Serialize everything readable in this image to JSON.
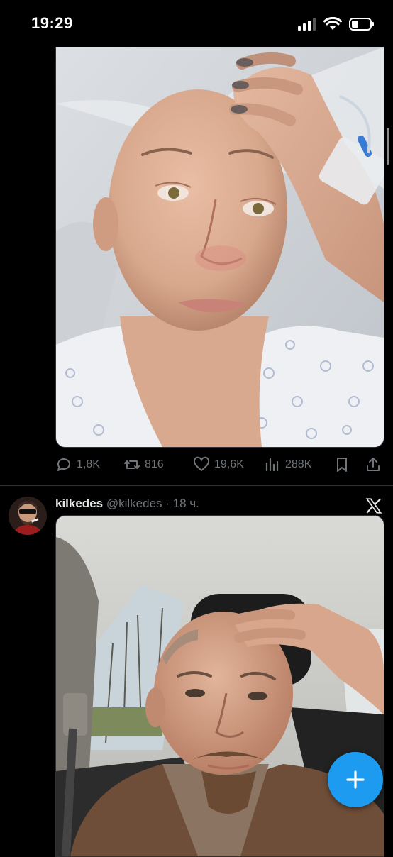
{
  "status_bar": {
    "time": "19:29"
  },
  "tweet1": {
    "actions": {
      "replies": "1,8K",
      "retweets": "816",
      "likes": "19,6K",
      "views": "288K"
    }
  },
  "tweet2": {
    "author_name": "kilkedes",
    "author_handle": "@kilkedes",
    "separator": "·",
    "time_ago": "18 ч."
  },
  "colors": {
    "accent": "#1d9bf0",
    "muted": "#71767b",
    "background": "#000000"
  },
  "icons": [
    "reply-icon",
    "retweet-icon",
    "like-icon",
    "views-icon",
    "bookmark-icon",
    "share-icon",
    "x-logo-icon",
    "compose-plus-icon"
  ]
}
